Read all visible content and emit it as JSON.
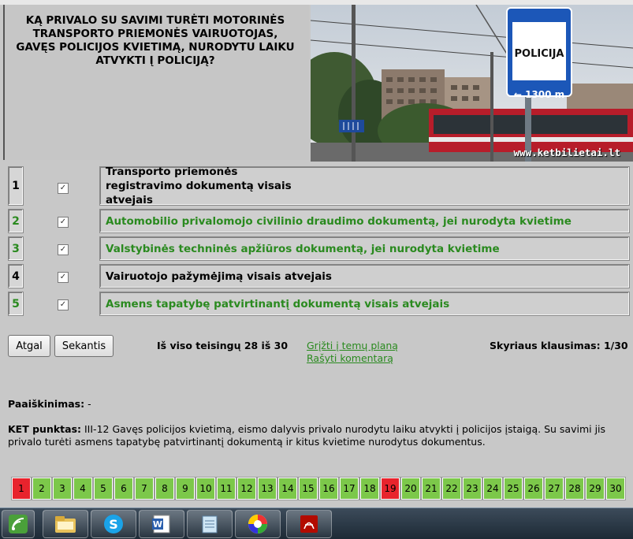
{
  "question": {
    "text": "KĄ PRIVALO SU SAVIMI TURĖTI MOTORINĖS TRANSPORTO PRIEMONĖS VAIRUOTOJAS, GAVĘS POLICIJOS KVIETIMĄ, NURODYTU LAIKU ATVYKTI Į POLICIJĄ?"
  },
  "photo": {
    "sign_title": "POLICIJA",
    "sign_distance": "← 1300 m",
    "watermark": "www.ketbilietai.lt"
  },
  "answers": [
    {
      "number": "1",
      "text": "Transporto priemonės registravimo dokumentą visais atvejais",
      "checked": true,
      "correct": false,
      "check_glyph": "✓"
    },
    {
      "number": "2",
      "text": "Automobilio privalomojo civilinio draudimo dokumentą, jei nurodyta kvietime",
      "checked": true,
      "correct": true,
      "check_glyph": "✓"
    },
    {
      "number": "3",
      "text": "Valstybinės techninės apžiūros dokumentą, jei nurodyta kvietime",
      "checked": true,
      "correct": true,
      "check_glyph": "✓"
    },
    {
      "number": "4",
      "text": "Vairuotojo pažymėjimą visais atvejais",
      "checked": true,
      "correct": false,
      "check_glyph": "✓"
    },
    {
      "number": "5",
      "text": "Asmens tapatybę patvirtinantį dokumentą visais atvejais",
      "checked": true,
      "correct": true,
      "check_glyph": "✓"
    }
  ],
  "controls": {
    "back_label": "Atgal",
    "next_label": "Sekantis",
    "score_text": "Iš viso teisingų 28 iš 30",
    "link_topics": "Grįžti į temų planą",
    "link_comment": "Rašyti komentarą",
    "section_text": "Skyriaus klausimas: 1/30"
  },
  "explanation": {
    "label": "Paaiškinimas:",
    "value": "-"
  },
  "ket": {
    "label": "KET punktas:",
    "text": "III-12 Gavęs policijos kvietimą, eismo dalyvis privalo nurodytu laiku atvykti į policijos įstaigą. Su savimi jis privalo turėti asmens tapatybę patvirtinantį dokumentą ir kitus kvietime nurodytus dokumentus."
  },
  "pager": [
    {
      "n": "1",
      "status": "wrong"
    },
    {
      "n": "2",
      "status": "correct"
    },
    {
      "n": "3",
      "status": "correct"
    },
    {
      "n": "4",
      "status": "correct"
    },
    {
      "n": "5",
      "status": "correct"
    },
    {
      "n": "6",
      "status": "correct"
    },
    {
      "n": "7",
      "status": "correct"
    },
    {
      "n": "8",
      "status": "correct"
    },
    {
      "n": "9",
      "status": "correct"
    },
    {
      "n": "10",
      "status": "correct"
    },
    {
      "n": "11",
      "status": "correct"
    },
    {
      "n": "12",
      "status": "correct"
    },
    {
      "n": "13",
      "status": "correct"
    },
    {
      "n": "14",
      "status": "correct"
    },
    {
      "n": "15",
      "status": "correct"
    },
    {
      "n": "16",
      "status": "correct"
    },
    {
      "n": "17",
      "status": "correct"
    },
    {
      "n": "18",
      "status": "correct"
    },
    {
      "n": "19",
      "status": "wrong"
    },
    {
      "n": "20",
      "status": "correct"
    },
    {
      "n": "21",
      "status": "correct"
    },
    {
      "n": "22",
      "status": "correct"
    },
    {
      "n": "23",
      "status": "correct"
    },
    {
      "n": "24",
      "status": "correct"
    },
    {
      "n": "25",
      "status": "correct"
    },
    {
      "n": "26",
      "status": "correct"
    },
    {
      "n": "27",
      "status": "correct"
    },
    {
      "n": "28",
      "status": "correct"
    },
    {
      "n": "29",
      "status": "correct"
    },
    {
      "n": "30",
      "status": "correct"
    }
  ],
  "colors": {
    "correct_green": "#2a8a1f",
    "pager_correct": "#7cc84a",
    "pager_wrong": "#e8232d",
    "panel_gray": "#c8c8c8"
  },
  "taskbar": {
    "items": [
      "network-status-icon",
      "file-explorer-icon",
      "skype-icon",
      "word-icon",
      "notepad-icon",
      "picasa-icon",
      "acrobat-reader-icon"
    ]
  }
}
